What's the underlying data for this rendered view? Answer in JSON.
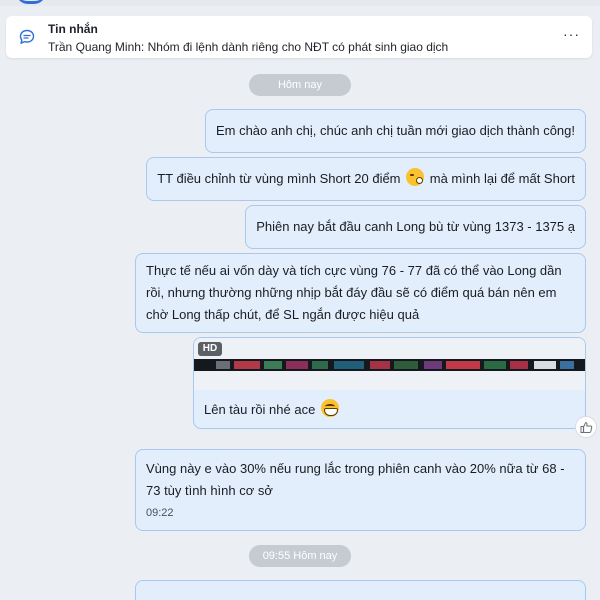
{
  "notice": {
    "title": "Tin nhắn",
    "text": "Trần Quang Minh: Nhóm đi lệnh dành riêng cho NĐT có phát sinh giao dịch",
    "more": "···"
  },
  "day_separators": [
    "Hôm nay",
    "09:55 Hôm nay"
  ],
  "messages": [
    {
      "text": "Em chào anh chị, chúc anh chị tuần mới giao dịch thành công!"
    },
    {
      "text_before": "TT điều chỉnh từ vùng mình Short 20 điểm",
      "emoji": "sleepy-face-icon",
      "text_after": "mà mình lại để mất Short"
    },
    {
      "text": "Phiên nay bắt đầu canh Long bù từ vùng 1373 - 1375 ạ"
    },
    {
      "lines": [
        "Thực tế nếu ai vốn dày và tích cực vùng 76 - 77 đã có thể vào Long dần",
        "rồi, nhưng thường những nhịp bắt đáy đầu sẽ có điểm quá bán nên em",
        "chờ Long thấp chút, để SL ngắn được hiệu quả"
      ]
    },
    {
      "media_badge": "HD",
      "caption": "Lên tàu rồi nhé ace",
      "emoji": "grinning-face-icon"
    },
    {
      "lines": [
        "Vùng này e vào 30% nếu rung lắc trong phiên canh vào 20% nữa từ 68 -",
        "73 tùy tình hình cơ sở"
      ],
      "time": "09:22"
    }
  ],
  "colors": {
    "background": "#ebeef3",
    "bubble_fill": "#e3eefc",
    "bubble_border": "#a9c8ef",
    "pill": "#c6cad1",
    "accent": "#2f6fd6"
  }
}
